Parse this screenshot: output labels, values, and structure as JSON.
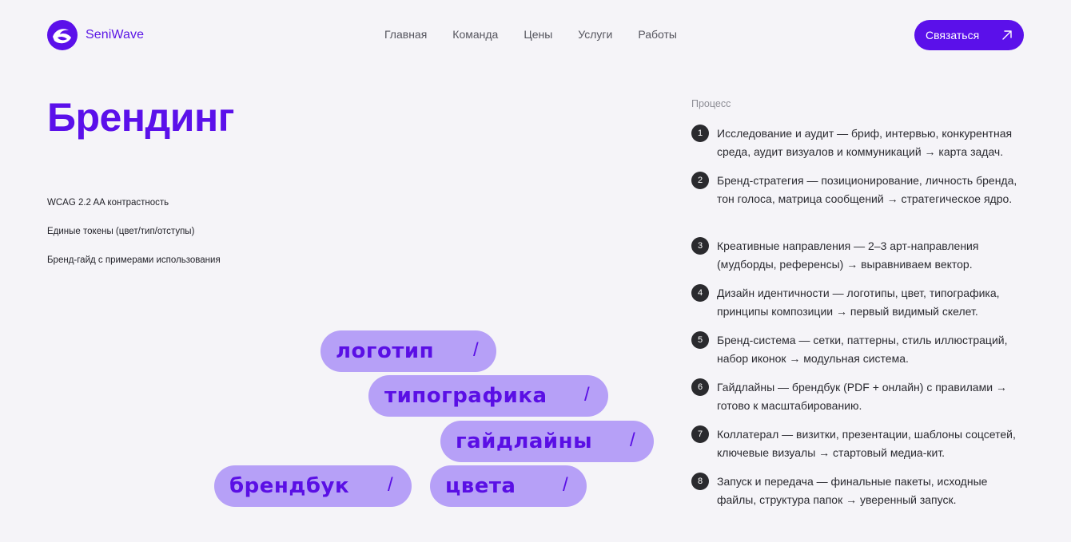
{
  "brand": {
    "name": "SeniWave",
    "logo_icon": "wave-circle-icon",
    "color": "#5b10ea"
  },
  "nav": [
    "Главная",
    "Команда",
    "Цены",
    "Услуги",
    "Работы"
  ],
  "cta": {
    "label": "Связаться",
    "icon": "arrow-up-right-icon"
  },
  "hero": {
    "title": "Брендинг",
    "features": [
      "WCAG 2.2 AA контрастность",
      "Единые токены (цвет/тип/отступы)",
      "Бренд-гайд с примерами использования"
    ]
  },
  "tags": [
    {
      "word": "логотип",
      "slash": "/"
    },
    {
      "word": "типографика",
      "slash": "/"
    },
    {
      "word": "гайдлайны",
      "slash": "/"
    },
    {
      "word": "брендбук",
      "slash": "/"
    },
    {
      "word": "цвета",
      "slash": "/"
    }
  ],
  "process": {
    "label": "Процесс",
    "steps": [
      {
        "num": "1",
        "text": "Исследование и аудит — бриф, интервью, конкурентная среда, аудит визуалов и коммуникаций → карта задач."
      },
      {
        "num": "2",
        "text": "Бренд-стратегия — позиционирование, личность бренда, тон голоса, матрица сообщений → стратегическое ядро."
      },
      {
        "num": "3",
        "text": "Креативные направления — 2–3 арт-направления (мудборды, референсы) → выравниваем вектор."
      },
      {
        "num": "4",
        "text": "Дизайн идентичности — логотипы, цвет, типографика, принципы композиции → первый видимый скелет."
      },
      {
        "num": "5",
        "text": "Бренд-система — сетки, паттерны, стиль иллюстраций, набор иконок → модульная система."
      },
      {
        "num": "6",
        "text": "Гайдлайны — брендбук (PDF + онлайн) с правилами → готово к масштабированию."
      },
      {
        "num": "7",
        "text": "Коллатерал — визитки, презентации, шаблоны соцсетей, ключевые визуалы → стартовый медиа-кит."
      },
      {
        "num": "8",
        "text": "Запуск и передача — финальные пакеты, исходные файлы, структура папок → уверенный запуск."
      }
    ]
  }
}
